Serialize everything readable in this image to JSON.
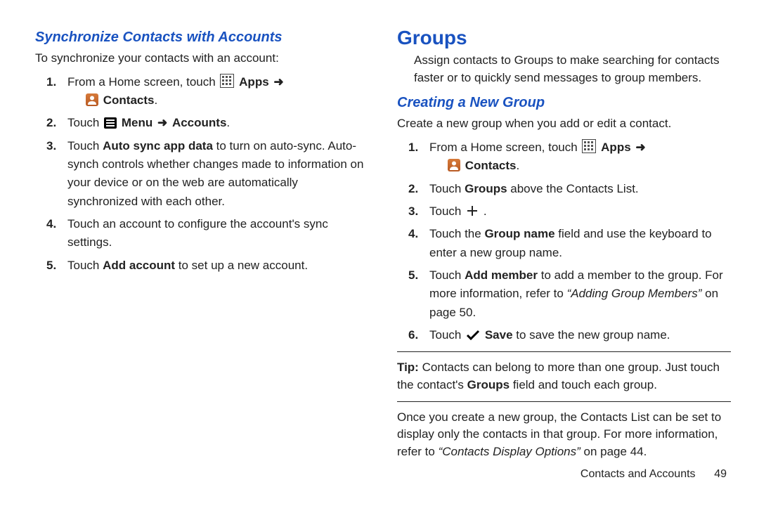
{
  "left": {
    "heading": "Synchronize Contacts with Accounts",
    "intro": "To synchronize your contacts with an account:",
    "steps": {
      "s1_pre": "From a Home screen, touch ",
      "s1_apps": "Apps",
      "s1_contacts": "Contacts",
      "s1_suffix": ".",
      "s2_pre": "Touch ",
      "s2_menu": "Menu",
      "s2_acc": "Accounts",
      "s2_suffix": ".",
      "s3_pre": "Touch ",
      "s3_bold": "Auto sync app data",
      "s3_post": " to turn on auto-sync. Auto-synch controls whether changes made to information on your device or on the web are automatically synchronized with each other.",
      "s4": "Touch an account to configure the account's sync settings.",
      "s5_pre": "Touch ",
      "s5_bold": "Add account",
      "s5_post": " to set up a new account."
    }
  },
  "right": {
    "groups_h": "Groups",
    "groups_intro": "Assign contacts to Groups to make searching for contacts faster or to quickly send messages to group members.",
    "create_h": "Creating a New Group",
    "create_intro": "Create a new group when you add or edit a contact.",
    "steps": {
      "s1_pre": "From a Home screen, touch ",
      "s1_apps": "Apps",
      "s1_contacts": "Contacts",
      "s1_suffix": ".",
      "s2_pre": "Touch ",
      "s2_bold": "Groups",
      "s2_post": " above the Contacts List.",
      "s3_pre": "Touch ",
      "s3_post": ".",
      "s4_pre": "Touch the ",
      "s4_bold": "Group name",
      "s4_post": " field and use the keyboard to enter a new group name.",
      "s5_pre": "Touch ",
      "s5_bold": "Add member",
      "s5_post": " to add a member to the group. For more information, refer to ",
      "s5_ref": "“Adding Group Members”",
      "s5_on": " on page ",
      "s5_page": "50",
      "s5_end": ".",
      "s6_pre": "Touch ",
      "s6_save": "Save",
      "s6_post": " to save the new group name."
    },
    "tip_label": "Tip:",
    "tip_pre": " Contacts can belong to more than one group. Just touch the contact's ",
    "tip_bold": "Groups",
    "tip_post": " field and touch each group.",
    "outro_pre": "Once you create a new group, the Contacts List can be set to display only the contacts in that group. For more information, refer to ",
    "outro_ref": "“Contacts Display Options”",
    "outro_on": "  on page ",
    "outro_page": "44",
    "outro_end": "."
  },
  "footer_chapter": "Contacts and Accounts",
  "footer_page": "49",
  "arrow": "➜"
}
